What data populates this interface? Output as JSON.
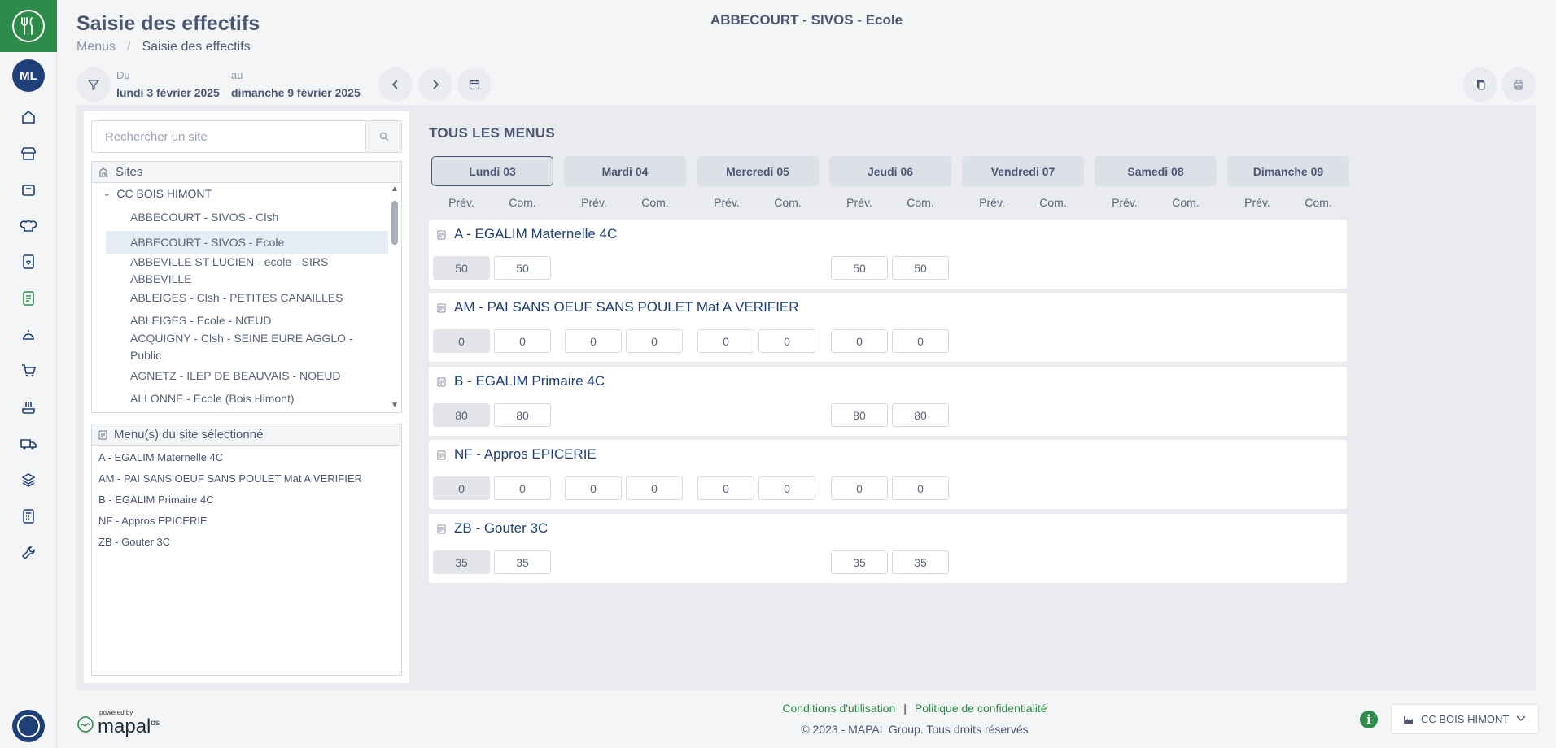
{
  "header": {
    "page_title": "Saisie des effectifs",
    "breadcrumb": [
      "Menus",
      "Saisie des effectifs"
    ],
    "site_title": "ABBECOURT - SIVOS - Ecole",
    "date_from_label": "Du",
    "date_from": "lundi 3 février 2025",
    "date_to_label": "au",
    "date_to": "dimanche 9 février 2025"
  },
  "rail": {
    "avatar": "ML"
  },
  "search": {
    "placeholder": "Rechercher un site"
  },
  "sites": {
    "title": "Sites",
    "root": "CC BOIS HIMONT",
    "items": [
      "ABBECOURT - SIVOS - Clsh",
      "ABBECOURT - SIVOS - Ecole",
      "ABBEVILLE ST LUCIEN - ecole - SIRS",
      "ABBEVILLE",
      "ABLEIGES - Clsh - PETITES CANAILLES",
      "ABLEIGES - Ecole - NŒUD",
      "ACQUIGNY - Clsh - SEINE EURE AGGLO -",
      "Public",
      "AGNETZ - ILEP DE BEAUVAIS - NOEUD",
      "ALLONNE - Ecole (Bois Himont)"
    ]
  },
  "site_menus": {
    "title": "Menu(s) du site sélectionné",
    "items": [
      "A - EGALIM Maternelle 4C",
      "AM - PAI SANS OEUF SANS POULET Mat A VERIFIER",
      "B - EGALIM Primaire 4C",
      "NF - Appros EPICERIE",
      "ZB - Gouter 3C"
    ]
  },
  "grid": {
    "title": "TOUS LES MENUS",
    "days": [
      "Lundi 03",
      "Mardi 04",
      "Mercredi 05",
      "Jeudi 06",
      "Vendredi 07",
      "Samedi 08",
      "Dimanche 09"
    ],
    "col_prev": "Prév.",
    "col_com": "Com.",
    "menus": [
      {
        "name": "A - EGALIM Maternelle 4C",
        "lun_prev": "50",
        "lun_com": "50",
        "mar_prev": "",
        "mar_com": "",
        "mer_prev": "",
        "mer_com": "",
        "jeu_prev": "50",
        "jeu_com": "50"
      },
      {
        "name": "AM - PAI SANS OEUF SANS POULET Mat A VERIFIER",
        "lun_prev": "0",
        "lun_com": "0",
        "mar_prev": "0",
        "mar_com": "0",
        "mer_prev": "0",
        "mer_com": "0",
        "jeu_prev": "0",
        "jeu_com": "0"
      },
      {
        "name": "B - EGALIM Primaire 4C",
        "lun_prev": "80",
        "lun_com": "80",
        "mar_prev": "",
        "mar_com": "",
        "mer_prev": "",
        "mer_com": "",
        "jeu_prev": "80",
        "jeu_com": "80"
      },
      {
        "name": "NF - Appros EPICERIE",
        "lun_prev": "0",
        "lun_com": "0",
        "mar_prev": "0",
        "mar_com": "0",
        "mer_prev": "0",
        "mer_com": "0",
        "jeu_prev": "0",
        "jeu_com": "0"
      },
      {
        "name": "ZB - Gouter 3C",
        "lun_prev": "35",
        "lun_com": "35",
        "mar_prev": "",
        "mar_com": "",
        "mer_prev": "",
        "mer_com": "",
        "jeu_prev": "35",
        "jeu_com": "35"
      }
    ]
  },
  "footer": {
    "terms": "Conditions d'utilisation",
    "separator": "|",
    "privacy": "Politique de confidentialité",
    "copyright": "© 2023 - MAPAL Group. Tous droits réservés",
    "powered_by": "powered by",
    "brand": "mapal",
    "brand_suffix": "os",
    "site_selector": "CC BOIS HIMONT"
  },
  "colors": {
    "accent": "#2e8b4a",
    "navy": "#1f3f78",
    "text": "#4c5773"
  }
}
